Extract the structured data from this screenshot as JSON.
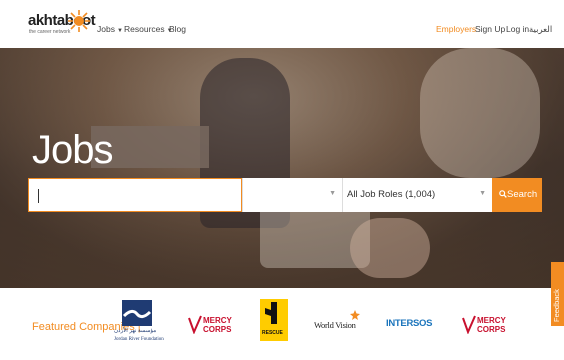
{
  "header": {
    "logo_text": "akhtaboot",
    "logo_tagline": "the career network",
    "nav": [
      {
        "label": "Jobs",
        "has_dropdown": true
      },
      {
        "label": "Resources",
        "has_dropdown": true
      },
      {
        "label": "Blog",
        "has_dropdown": false
      }
    ],
    "right_links": {
      "employers": "Employers",
      "signup": "Sign Up",
      "login": "Log in",
      "language": "العربية"
    }
  },
  "hero": {
    "title": "Jobs",
    "search": {
      "value": "",
      "placeholder": ""
    },
    "location_select": {
      "selected": ""
    },
    "role_select": {
      "selected": "All Job Roles (1,004)"
    },
    "search_button": "Search"
  },
  "featured": {
    "label": "Featured Companies |",
    "companies": [
      {
        "name": "Jordan River Foundation",
        "arabic": "مؤسسة نهر الأردن"
      },
      {
        "name": "MERCY CORPS"
      },
      {
        "name": "RESCUE"
      },
      {
        "name": "World Vision"
      },
      {
        "name": "INTERSOS"
      },
      {
        "name": "MERCY CORPS"
      }
    ]
  },
  "feedback_tab": "Feedback",
  "colors": {
    "accent": "#f28c22",
    "mercy_red": "#c8102e",
    "intersos_blue": "#1c75bc",
    "rescue_yellow": "#ffcc00"
  }
}
